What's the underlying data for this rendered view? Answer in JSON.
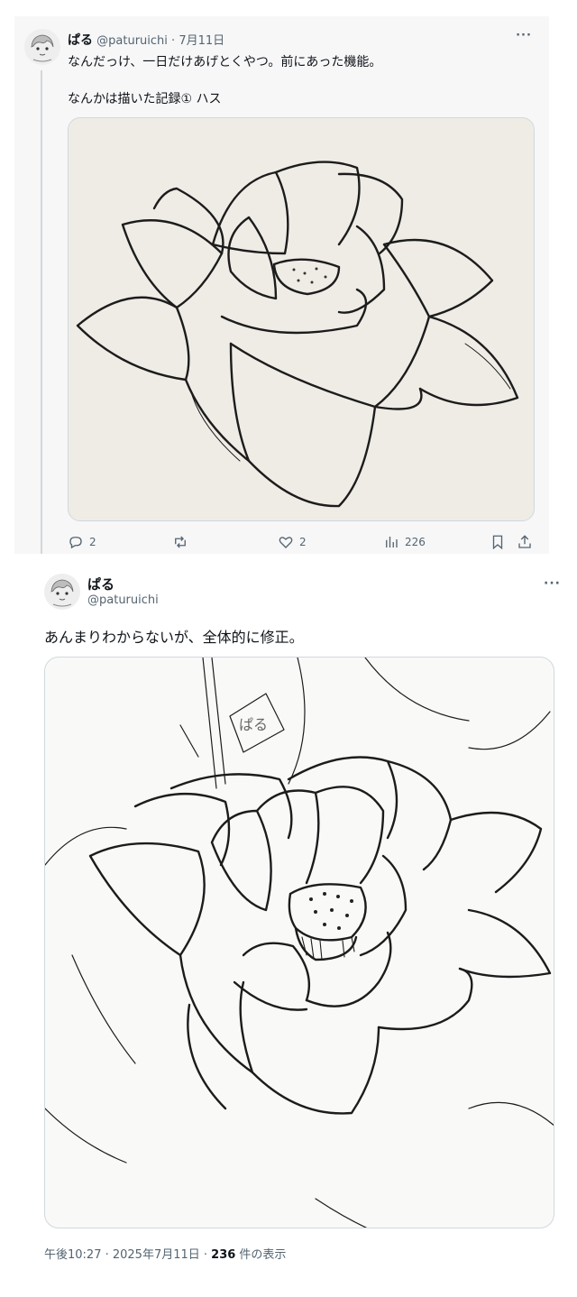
{
  "tweet1": {
    "name": "ぱる",
    "handle": "@paturuichi",
    "dot": "·",
    "date": "7月11日",
    "more_icon": "more-icon",
    "text_line1": "なんだっけ、一日だけあげとくやつ。前にあった機能。",
    "text_line2": "なんかは描いた記録① ハス",
    "media_name": "lotus-sketch-image",
    "actions": {
      "reply_count": "2",
      "retweet_count": "",
      "like_count": "2",
      "views_count": "226"
    }
  },
  "tweet2": {
    "name": "ぱる",
    "handle": "@paturuichi",
    "more_icon": "more-icon",
    "text": "あんまりわからないが、全体的に修正。",
    "media_name": "lotus-sketch-revised-image",
    "meta_time": "午後10:27 · 2025年7月11日 · ",
    "meta_views_count": "236",
    "meta_views_label": " 件の表示"
  },
  "colors": {
    "secondary_text": "#536471",
    "border": "#cfd9de",
    "thread_bg": "#f7f7f8"
  }
}
